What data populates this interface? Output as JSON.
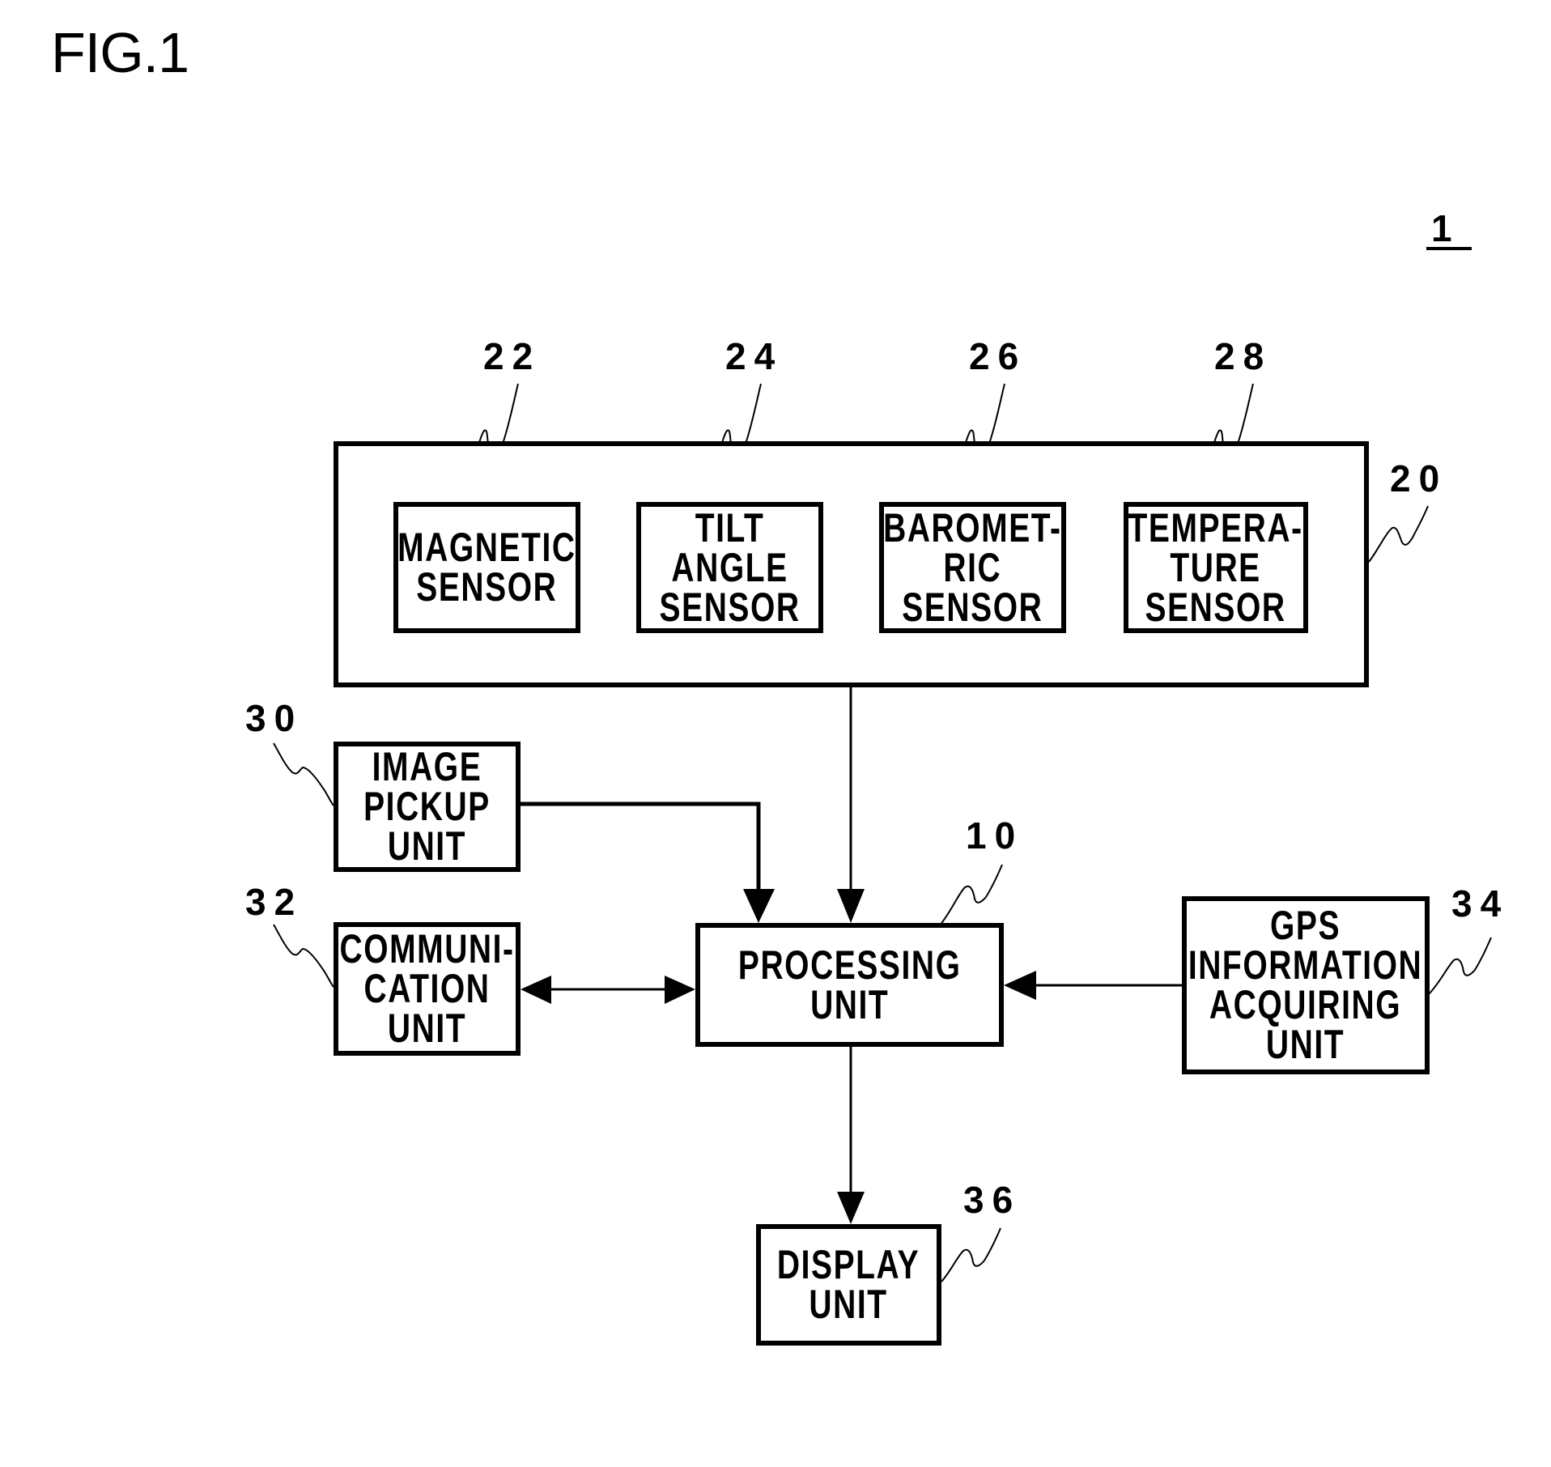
{
  "figure": {
    "title": "FIG.1",
    "device_ref": "1"
  },
  "diagram": {
    "sensor_group": {
      "ref": "20",
      "sensors": [
        {
          "ref": "22",
          "lines": [
            "MAGNETIC",
            "SENSOR"
          ]
        },
        {
          "ref": "24",
          "lines": [
            "TILT",
            "ANGLE",
            "SENSOR"
          ]
        },
        {
          "ref": "26",
          "lines": [
            "BAROMET-",
            "RIC",
            "SENSOR"
          ]
        },
        {
          "ref": "28",
          "lines": [
            "TEMPERA-",
            "TURE",
            "SENSOR"
          ]
        }
      ]
    },
    "image_pickup": {
      "ref": "30",
      "lines": [
        "IMAGE",
        "PICKUP",
        "UNIT"
      ]
    },
    "communication": {
      "ref": "32",
      "lines": [
        "COMMUNI-",
        "CATION",
        "UNIT"
      ]
    },
    "processing": {
      "ref": "10",
      "lines": [
        "PROCESSING",
        "UNIT"
      ]
    },
    "gps": {
      "ref": "34",
      "lines": [
        "GPS",
        "INFORMATION",
        "ACQUIRING",
        "UNIT"
      ]
    },
    "display": {
      "ref": "36",
      "lines": [
        "DISPLAY",
        "UNIT"
      ]
    },
    "connections": [
      {
        "from": "sensor_group",
        "to": "processing",
        "type": "arrow"
      },
      {
        "from": "image_pickup",
        "to": "processing",
        "type": "arrow"
      },
      {
        "from": "communication",
        "to": "processing",
        "type": "bidirectional"
      },
      {
        "from": "gps",
        "to": "processing",
        "type": "arrow"
      },
      {
        "from": "processing",
        "to": "display",
        "type": "arrow"
      }
    ]
  }
}
